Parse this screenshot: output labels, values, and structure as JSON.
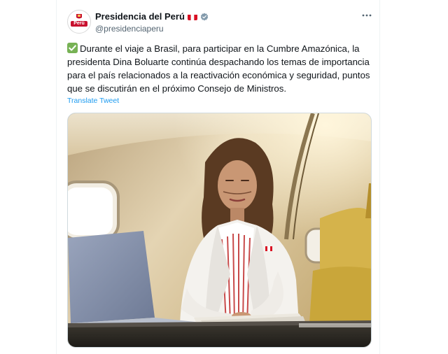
{
  "author": {
    "name": "Presidencia del Perú",
    "handle": "@presidenciaperu",
    "avatar_text": "Perú",
    "flag_icon": "peru-flag-icon",
    "verified_icon": "verified-badge-icon",
    "verified_color": "#829aab"
  },
  "tweet": {
    "emoji_icon": "check-mark-button-icon",
    "text": "Durante el viaje a Brasil, para participar en la Cumbre Amazónica, la presidenta Dina Boluarte continúa despachando los temas de importancia para el país relacionados a la reactivación económica y seguridad, puntos que se discutirán en el próximo Consejo de Ministros.",
    "translate_label": "Translate Tweet"
  },
  "colors": {
    "link": "#1d9bf0",
    "secondary_text": "#536471",
    "check_green": "#77b255",
    "flag_red": "#d91023"
  }
}
